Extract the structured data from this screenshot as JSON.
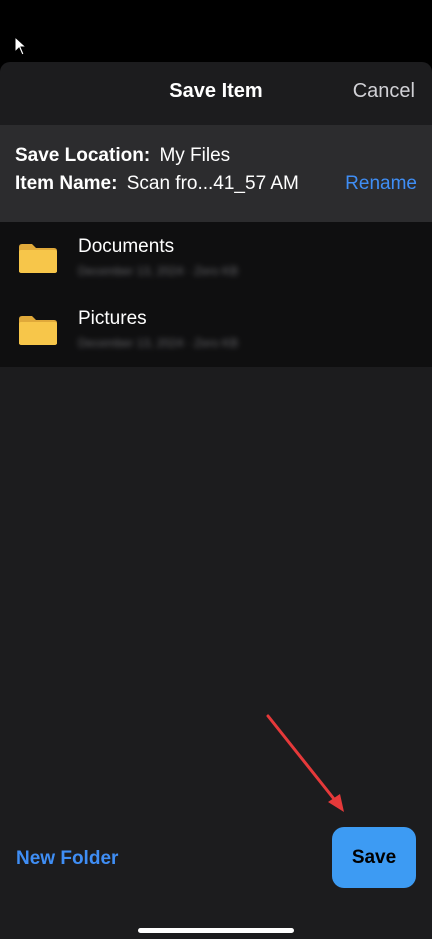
{
  "header": {
    "title": "Save Item",
    "cancel_label": "Cancel"
  },
  "info": {
    "location_label": "Save Location:",
    "location_value": "My Files",
    "name_label": "Item Name:",
    "name_value": "Scan fro...41_57 AM",
    "rename_label": "Rename"
  },
  "folders": [
    {
      "name": "Documents",
      "meta": "December 13, 2024 · Zero KB"
    },
    {
      "name": "Pictures",
      "meta": "December 13, 2024 · Zero KB"
    }
  ],
  "footer": {
    "new_folder_label": "New Folder",
    "save_label": "Save"
  },
  "colors": {
    "accent": "#3f8ef5",
    "save_button": "#3d9bf3",
    "folder": "#f7c64a",
    "annotation_arrow": "#e5393a"
  }
}
